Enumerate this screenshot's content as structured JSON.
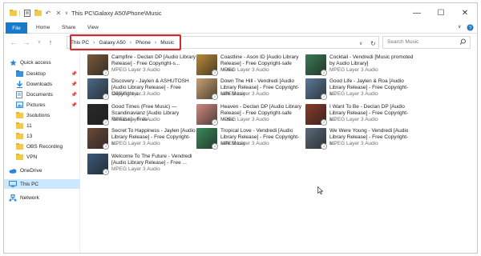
{
  "window": {
    "title": "This PC\\Galaxy A50\\Phone\\Music"
  },
  "titlebar": {
    "dropdown_glyph": "∨"
  },
  "ribbon": {
    "tabs": [
      "File",
      "Home",
      "Share",
      "View"
    ]
  },
  "address": {
    "crumbs": [
      "This PC",
      "Galaxy A50",
      "Phone",
      "Music"
    ],
    "highlight_color": "#d9272e"
  },
  "search": {
    "placeholder": "Search Music"
  },
  "sidebar": {
    "items": [
      {
        "label": "Quick access",
        "icon": "star-icon"
      },
      {
        "label": "Desktop",
        "icon": "desktop-folder-icon",
        "pinned": true
      },
      {
        "label": "Downloads",
        "icon": "download-folder-icon",
        "pinned": true
      },
      {
        "label": "Documents",
        "icon": "documents-folder-icon",
        "pinned": true
      },
      {
        "label": "Pictures",
        "icon": "pictures-folder-icon",
        "pinned": true
      },
      {
        "label": "3solutions",
        "icon": "folder-icon"
      },
      {
        "label": "11",
        "icon": "folder-icon"
      },
      {
        "label": "13",
        "icon": "folder-icon"
      },
      {
        "label": "OBS Recording",
        "icon": "folder-icon"
      },
      {
        "label": "VPN",
        "icon": "folder-icon"
      },
      {
        "label": "OneDrive",
        "icon": "cloud-icon"
      },
      {
        "label": "This PC",
        "icon": "computer-icon",
        "selected": true
      },
      {
        "label": "Network",
        "icon": "network-icon"
      }
    ]
  },
  "files": [
    {
      "name": "Campfire - Declan DP [Audio Library Release] - Free Copyright-s...",
      "type": "MPEG Layer 3 Audio",
      "color": "#7a5a3a"
    },
    {
      "name": "Coastline - Ason ID [Audio Library Release] - Free Copyright-safe Music",
      "type": "MPEG Layer 3 Audio",
      "color": "#b98a3a"
    },
    {
      "name": "Cocktail - Vendredi [Music promoted by Audio Library]",
      "type": "MPEG Layer 3 Audio",
      "color": "#3a7a55"
    },
    {
      "name": "Discovery - Jaylen & ASHUTOSH [Audio Library Release] - Free Copyright-s...",
      "type": "MPEG Layer 3 Audio",
      "color": "#4a6a8a"
    },
    {
      "name": "Down The Hill - Vendredi [Audio Library Release] - Free Copyright-safe Music",
      "type": "MPEG Layer 3 Audio",
      "color": "#c9a070"
    },
    {
      "name": "Good Life - Jaylen & Roa [Audio Library Release] - Free Copyright-s...",
      "type": "MPEG Layer 3 Audio",
      "color": "#5a7a9a"
    },
    {
      "name": "Good Times (Free Music) — Scandinavianz [Audio Library Release] - Free ...",
      "type": "MPEG Layer 3 Audio",
      "color": "#2a2a2a"
    },
    {
      "name": "Heaven - Declan DP [Audio Library Release] - Free Copyright-safe Music",
      "type": "MPEG Layer 3 Audio",
      "color": "#d08a80"
    },
    {
      "name": "I Want To Be - Declan DP [Audio Library Release] - Free Copyright-s...",
      "type": "MPEG Layer 3 Audio",
      "color": "#8a3a2a"
    },
    {
      "name": "Secret To Happiness - Jaylen [Audio Library Release] - Free Copyright-s...",
      "type": "MPEG Layer 3 Audio",
      "color": "#6a4a3a"
    },
    {
      "name": "Tropical Love - Vendredi [Audio Library Release] - Free Copyright-safe Music",
      "type": "MPEG Layer 3 Audio",
      "color": "#3a8a5a"
    },
    {
      "name": "We Were Young - Vendredi [Audio Library Release] - Free Copyright-s...",
      "type": "MPEG Layer 3 Audio",
      "color": "#5a6a7a"
    },
    {
      "name": "Welcome To The Future - Vendredi [Audio Library Release] - Free ...",
      "type": "MPEG Layer 3 Audio",
      "color": "#3a5a7a"
    }
  ]
}
